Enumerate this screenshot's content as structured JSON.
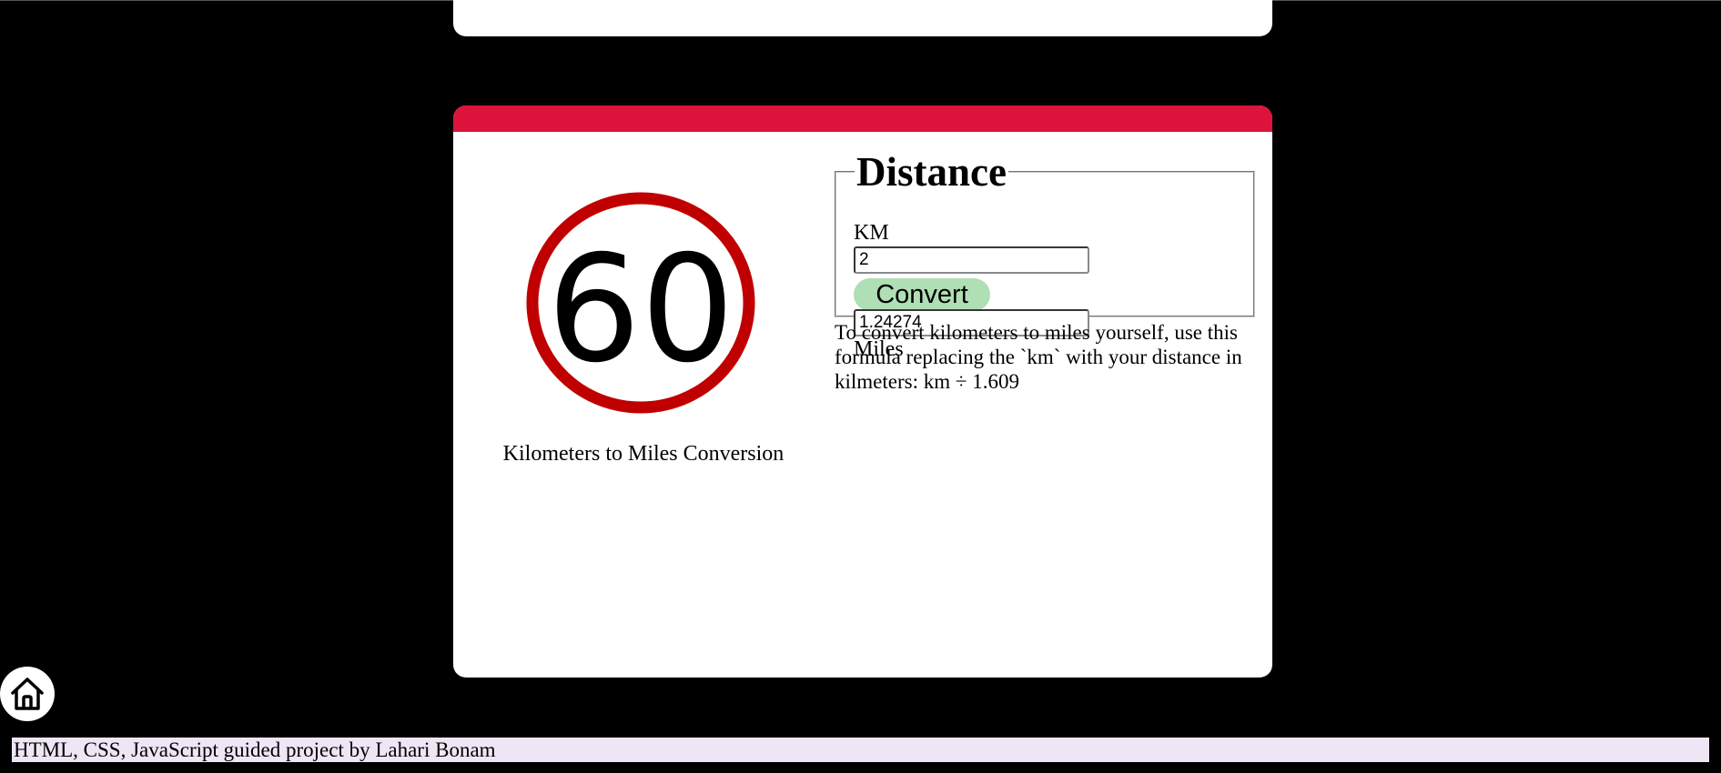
{
  "converter": {
    "sign_number": "60",
    "caption": "Kilometers to Miles Conversion",
    "legend": "Distance",
    "km_label": "KM",
    "km_value": "2",
    "convert_label": "Convert",
    "miles_value": "1.24274",
    "miles_label": "Miles",
    "formula_text": "To convert kilometers to miles yourself, use this formula replacing the `km` with your distance in kilmeters: km ÷ 1.609"
  },
  "footer": {
    "text": "HTML, CSS, JavaScript guided project by Lahari Bonam"
  },
  "colors": {
    "accent": "#dc143c",
    "sign_ring": "#c00000",
    "button": "#b0deb5",
    "footer_bg": "#efe6f5"
  },
  "icons": {
    "home": "home-icon"
  }
}
